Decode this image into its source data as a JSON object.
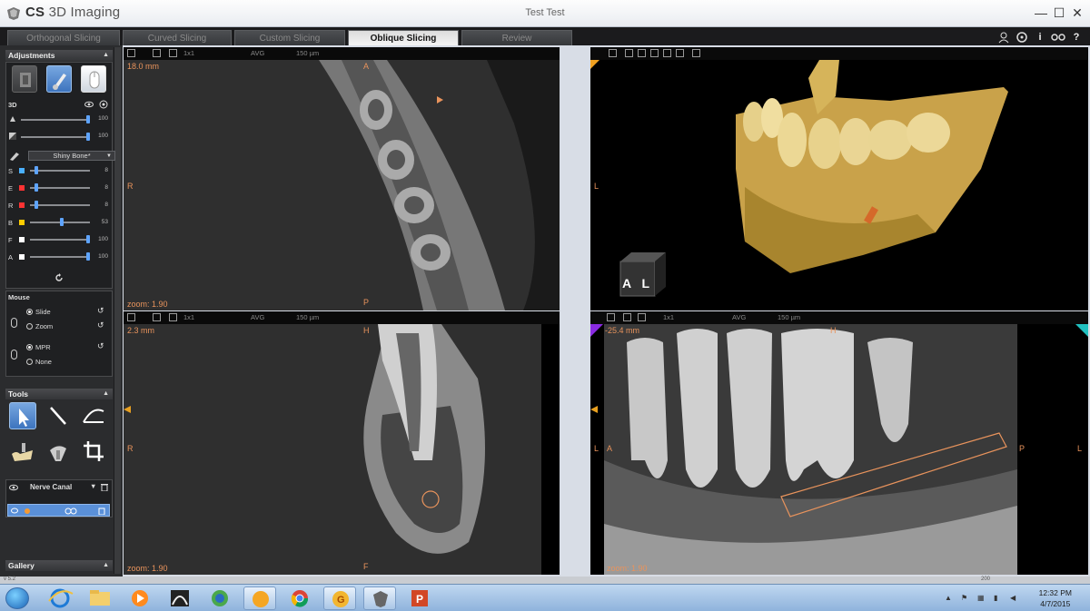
{
  "window": {
    "app_name_bold": "CS",
    "app_name_rest": " 3D Imaging",
    "document_title": "Test Test",
    "minimize": "—",
    "maximize": "☐",
    "close": "✕"
  },
  "tabs": [
    {
      "label": "Orthogonal Slicing",
      "active": false
    },
    {
      "label": "Curved Slicing",
      "active": false
    },
    {
      "label": "Custom Slicing",
      "active": false
    },
    {
      "label": "Oblique Slicing",
      "active": true
    },
    {
      "label": "Review",
      "active": false
    }
  ],
  "top_right_icons": [
    "user-icon",
    "target-icon",
    "info-icon",
    "settings-icon",
    "help-icon"
  ],
  "top_right_labels": {
    "info": "i",
    "help": "?"
  },
  "left_panel": {
    "adjustments_header": "Adjustments",
    "section_3d": "3D",
    "sliders_3d": [
      {
        "icon": "brightness-icon",
        "value": "100",
        "fraction": 1.0
      },
      {
        "icon": "contrast-icon",
        "value": "100",
        "fraction": 1.0
      }
    ],
    "preset": "Shiny Bone*",
    "channels": [
      {
        "letter": "S",
        "color": "#4ab0ff",
        "value": "8",
        "fraction": 0.08
      },
      {
        "letter": "E",
        "color": "#ff3333",
        "value": "8",
        "fraction": 0.08
      },
      {
        "letter": "R",
        "color": "#ff3333",
        "value": "8",
        "fraction": 0.08
      },
      {
        "letter": "B",
        "color": "#ffcc00",
        "value": "53",
        "fraction": 0.53
      },
      {
        "letter": "F",
        "color": "#ffffff",
        "value": "100",
        "fraction": 1.0
      },
      {
        "letter": "A",
        "color": "#ffffff",
        "value": "100",
        "fraction": 1.0
      }
    ],
    "mouse_header": "Mouse",
    "mouse_options": [
      {
        "label": "Slide",
        "selected": true
      },
      {
        "label": "Zoom",
        "selected": false
      },
      {
        "label": "MPR",
        "selected": true
      },
      {
        "label": "None",
        "selected": false
      }
    ],
    "tools_header": "Tools",
    "tools": [
      "pointer-tool",
      "line-measure-tool",
      "angle-measure-tool",
      "jaw-tool",
      "implant-tool",
      "crop-tool"
    ],
    "nerve_canal_label": "Nerve Canal",
    "gallery_header": "Gallery"
  },
  "viewports": {
    "top_left": {
      "mm": "18.0 mm",
      "zoom": "zoom: 1.90",
      "orient_top": "A",
      "orient_left": "R",
      "orient_bottom": "P",
      "thickness": "150 µm",
      "avg": "AVG",
      "grid": "1x1"
    },
    "top_right": {
      "orient_left": "L",
      "cube_letters": "A L"
    },
    "bottom_left": {
      "mm": "2.3 mm",
      "zoom": "zoom: 1.90",
      "orient_top": "H",
      "orient_left": "R",
      "orient_bottom": "F",
      "thickness": "150 µm",
      "avg": "AVG",
      "grid": "1x1"
    },
    "bottom_right": {
      "mm": "-25.4 mm",
      "zoom": "zoom: 1.90",
      "orient_top": "H",
      "orient_left": "L",
      "orient_left2": "A",
      "orient_right": "P",
      "orient_right2": "L",
      "thickness": "150 µm",
      "avg": "AVG",
      "grid": "1x1"
    }
  },
  "status_strip": "v 5.2",
  "status_right": "200",
  "taskbar": {
    "time": "12:32 PM",
    "date": "4/7/2015",
    "apps": [
      "windows-start",
      "internet-explorer",
      "file-explorer",
      "media-player",
      "photo-app",
      "network-app",
      "music-app",
      "chrome",
      "g-app",
      "cs-imaging",
      "powerpoint"
    ]
  },
  "colors": {
    "accent_blue": "#5ea4ff",
    "annotation_orange": "#e8935c",
    "bone_gold": "#d6b45a"
  }
}
